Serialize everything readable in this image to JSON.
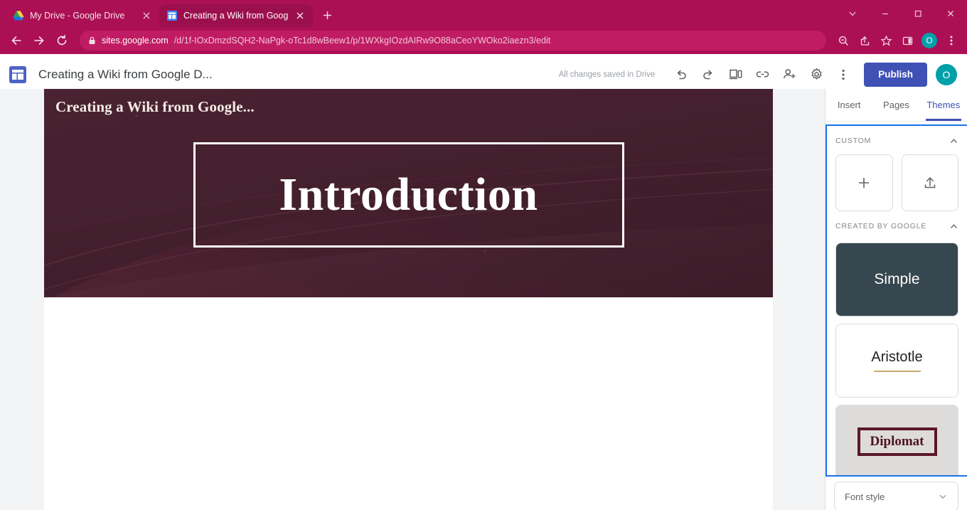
{
  "browser": {
    "tabs": [
      {
        "title": "My Drive - Google Drive",
        "favicon": "google-drive-icon",
        "active": false
      },
      {
        "title": "Creating a Wiki from Google Doc",
        "favicon": "google-sites-icon",
        "active": true
      }
    ],
    "new_tab_label": "+",
    "window_controls": [
      "tab-search-chevron",
      "minimize",
      "maximize",
      "close"
    ],
    "nav": {
      "back": "back-arrow",
      "forward": "forward-arrow",
      "reload": "reload-icon"
    },
    "url": {
      "lock": "lock-icon",
      "domain": "sites.google.com",
      "path": "/d/1f-IOxDmzdSQH2-NaPgk-oTc1d8wBeew1/p/1WXkgIOzdAIRw9O88aCeoYWOko2iaezn3/edit",
      "full": "sites.google.com/d/1f-IOxDmzdSQH2-NaPgk-oTc1d8wBeew1/p/1WXkgIOzdAIRw9O88aCeoYWOko2iaezn3/edit"
    },
    "omnibox_icons": [
      "zoom-icon",
      "share-icon",
      "bookmark-star-icon",
      "side-panel-icon"
    ],
    "profile_initial": "O",
    "menu_icon": "three-dot-menu-icon",
    "chrome_accent": "#ac1054"
  },
  "appbar": {
    "app_icon": "google-sites-icon",
    "doc_title": "Creating a Wiki from Google D...",
    "save_status": "All changes saved in Drive",
    "icons": [
      "undo-icon",
      "redo-icon",
      "preview-icon",
      "copy-link-icon",
      "add-editor-icon",
      "settings-gear-icon",
      "more-vert-icon"
    ],
    "publish_label": "Publish",
    "publish_color": "#3f51b5",
    "avatar_initial": "O",
    "avatar_color": "#00a0a8"
  },
  "canvas": {
    "site_title": "Creating a Wiki from Google...",
    "page_title": "Introduction",
    "banner_color": "#45202e",
    "title_box_border": "#ffffff"
  },
  "panel": {
    "tabs": [
      {
        "label": "Insert",
        "active": false
      },
      {
        "label": "Pages",
        "active": false
      },
      {
        "label": "Themes",
        "active": true
      }
    ],
    "sections": [
      {
        "label": "CUSTOM",
        "collapse_icon": "chevron-up-icon"
      },
      {
        "label": "CREATED BY GOOGLE",
        "collapse_icon": "chevron-up-icon"
      }
    ],
    "custom_actions": [
      {
        "name": "add-theme",
        "icon": "plus-icon"
      },
      {
        "name": "upload-theme",
        "icon": "upload-icon"
      }
    ],
    "themes": [
      {
        "name": "Simple",
        "selected": false
      },
      {
        "name": "Aristotle",
        "selected": false
      },
      {
        "name": "Diplomat",
        "selected": true
      }
    ],
    "diplomat_swatches": [
      {
        "color": "#2f3133",
        "selected": false
      },
      {
        "color": "#1d3c56",
        "selected": false
      },
      {
        "color": "#5c1b2f",
        "selected": true
      },
      {
        "color": "#1f5143",
        "selected": false
      },
      {
        "color": "#3b3f63",
        "selected": false
      }
    ],
    "custom_color_icon": "paint-bucket-icon",
    "font_style_label": "Font style",
    "font_style_caret": "chevron-down-icon",
    "focus_border_color": "#1a73e8"
  }
}
